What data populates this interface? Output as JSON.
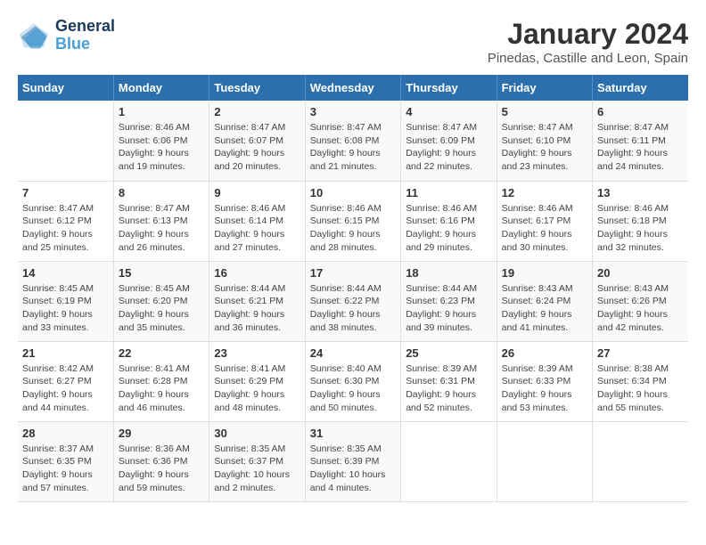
{
  "logo": {
    "line1": "General",
    "line2": "Blue"
  },
  "title": "January 2024",
  "location": "Pinedas, Castille and Leon, Spain",
  "weekdays": [
    "Sunday",
    "Monday",
    "Tuesday",
    "Wednesday",
    "Thursday",
    "Friday",
    "Saturday"
  ],
  "weeks": [
    [
      {
        "day": "",
        "info": ""
      },
      {
        "day": "1",
        "info": "Sunrise: 8:46 AM\nSunset: 6:06 PM\nDaylight: 9 hours\nand 19 minutes."
      },
      {
        "day": "2",
        "info": "Sunrise: 8:47 AM\nSunset: 6:07 PM\nDaylight: 9 hours\nand 20 minutes."
      },
      {
        "day": "3",
        "info": "Sunrise: 8:47 AM\nSunset: 6:08 PM\nDaylight: 9 hours\nand 21 minutes."
      },
      {
        "day": "4",
        "info": "Sunrise: 8:47 AM\nSunset: 6:09 PM\nDaylight: 9 hours\nand 22 minutes."
      },
      {
        "day": "5",
        "info": "Sunrise: 8:47 AM\nSunset: 6:10 PM\nDaylight: 9 hours\nand 23 minutes."
      },
      {
        "day": "6",
        "info": "Sunrise: 8:47 AM\nSunset: 6:11 PM\nDaylight: 9 hours\nand 24 minutes."
      }
    ],
    [
      {
        "day": "7",
        "info": "Sunrise: 8:47 AM\nSunset: 6:12 PM\nDaylight: 9 hours\nand 25 minutes."
      },
      {
        "day": "8",
        "info": "Sunrise: 8:47 AM\nSunset: 6:13 PM\nDaylight: 9 hours\nand 26 minutes."
      },
      {
        "day": "9",
        "info": "Sunrise: 8:46 AM\nSunset: 6:14 PM\nDaylight: 9 hours\nand 27 minutes."
      },
      {
        "day": "10",
        "info": "Sunrise: 8:46 AM\nSunset: 6:15 PM\nDaylight: 9 hours\nand 28 minutes."
      },
      {
        "day": "11",
        "info": "Sunrise: 8:46 AM\nSunset: 6:16 PM\nDaylight: 9 hours\nand 29 minutes."
      },
      {
        "day": "12",
        "info": "Sunrise: 8:46 AM\nSunset: 6:17 PM\nDaylight: 9 hours\nand 30 minutes."
      },
      {
        "day": "13",
        "info": "Sunrise: 8:46 AM\nSunset: 6:18 PM\nDaylight: 9 hours\nand 32 minutes."
      }
    ],
    [
      {
        "day": "14",
        "info": "Sunrise: 8:45 AM\nSunset: 6:19 PM\nDaylight: 9 hours\nand 33 minutes."
      },
      {
        "day": "15",
        "info": "Sunrise: 8:45 AM\nSunset: 6:20 PM\nDaylight: 9 hours\nand 35 minutes."
      },
      {
        "day": "16",
        "info": "Sunrise: 8:44 AM\nSunset: 6:21 PM\nDaylight: 9 hours\nand 36 minutes."
      },
      {
        "day": "17",
        "info": "Sunrise: 8:44 AM\nSunset: 6:22 PM\nDaylight: 9 hours\nand 38 minutes."
      },
      {
        "day": "18",
        "info": "Sunrise: 8:44 AM\nSunset: 6:23 PM\nDaylight: 9 hours\nand 39 minutes."
      },
      {
        "day": "19",
        "info": "Sunrise: 8:43 AM\nSunset: 6:24 PM\nDaylight: 9 hours\nand 41 minutes."
      },
      {
        "day": "20",
        "info": "Sunrise: 8:43 AM\nSunset: 6:26 PM\nDaylight: 9 hours\nand 42 minutes."
      }
    ],
    [
      {
        "day": "21",
        "info": "Sunrise: 8:42 AM\nSunset: 6:27 PM\nDaylight: 9 hours\nand 44 minutes."
      },
      {
        "day": "22",
        "info": "Sunrise: 8:41 AM\nSunset: 6:28 PM\nDaylight: 9 hours\nand 46 minutes."
      },
      {
        "day": "23",
        "info": "Sunrise: 8:41 AM\nSunset: 6:29 PM\nDaylight: 9 hours\nand 48 minutes."
      },
      {
        "day": "24",
        "info": "Sunrise: 8:40 AM\nSunset: 6:30 PM\nDaylight: 9 hours\nand 50 minutes."
      },
      {
        "day": "25",
        "info": "Sunrise: 8:39 AM\nSunset: 6:31 PM\nDaylight: 9 hours\nand 52 minutes."
      },
      {
        "day": "26",
        "info": "Sunrise: 8:39 AM\nSunset: 6:33 PM\nDaylight: 9 hours\nand 53 minutes."
      },
      {
        "day": "27",
        "info": "Sunrise: 8:38 AM\nSunset: 6:34 PM\nDaylight: 9 hours\nand 55 minutes."
      }
    ],
    [
      {
        "day": "28",
        "info": "Sunrise: 8:37 AM\nSunset: 6:35 PM\nDaylight: 9 hours\nand 57 minutes."
      },
      {
        "day": "29",
        "info": "Sunrise: 8:36 AM\nSunset: 6:36 PM\nDaylight: 9 hours\nand 59 minutes."
      },
      {
        "day": "30",
        "info": "Sunrise: 8:35 AM\nSunset: 6:37 PM\nDaylight: 10 hours\nand 2 minutes."
      },
      {
        "day": "31",
        "info": "Sunrise: 8:35 AM\nSunset: 6:39 PM\nDaylight: 10 hours\nand 4 minutes."
      },
      {
        "day": "",
        "info": ""
      },
      {
        "day": "",
        "info": ""
      },
      {
        "day": "",
        "info": ""
      }
    ]
  ]
}
